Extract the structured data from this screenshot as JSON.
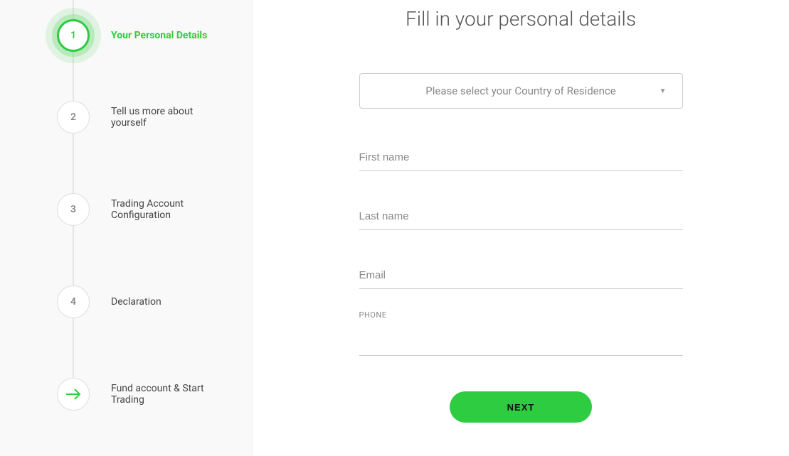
{
  "sidebar": {
    "steps": [
      {
        "number": "1",
        "label": "Your Personal Details",
        "active": true
      },
      {
        "number": "2",
        "label": "Tell us more about yourself",
        "active": false
      },
      {
        "number": "3",
        "label": "Trading Account Configuration",
        "active": false
      },
      {
        "number": "4",
        "label": "Declaration",
        "active": false
      }
    ],
    "final_step_label": "Fund account & Start Trading"
  },
  "main": {
    "title": "Fill in your personal details",
    "country_select_placeholder": "Please select your Country of Residence",
    "first_name_placeholder": "First name",
    "last_name_placeholder": "Last name",
    "email_placeholder": "Email",
    "phone_label": "PHONE",
    "next_button_label": "NEXT"
  }
}
